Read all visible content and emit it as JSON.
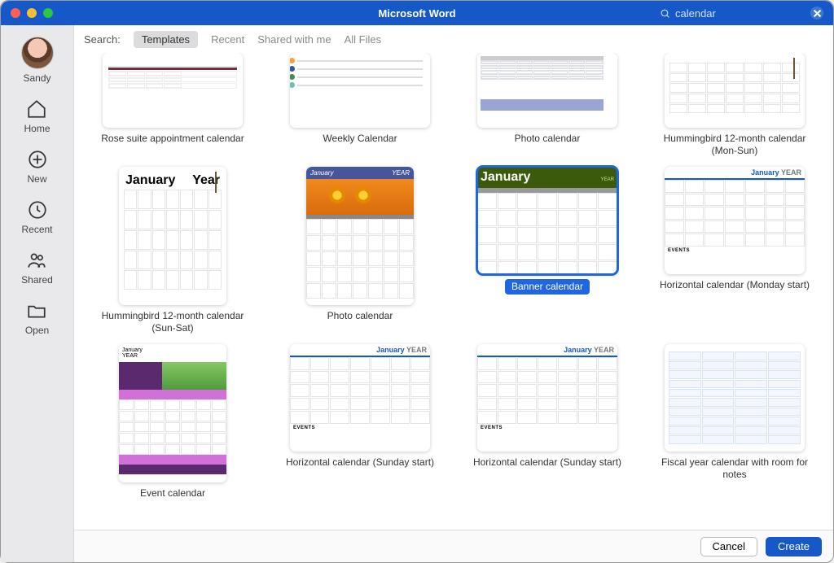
{
  "titlebar": {
    "title": "Microsoft Word"
  },
  "search": {
    "value": "calendar"
  },
  "user": {
    "name": "Sandy"
  },
  "sidebar": {
    "home": "Home",
    "new": "New",
    "recent": "Recent",
    "shared": "Shared",
    "open": "Open"
  },
  "filter": {
    "label": "Search:",
    "tabs": [
      "Templates",
      "Recent",
      "Shared with me",
      "All Files"
    ],
    "active_index": 0
  },
  "templates": [
    {
      "label": "Rose suite appointment calendar",
      "shape": "short",
      "kind": "rose"
    },
    {
      "label": "Weekly Calendar",
      "shape": "short",
      "kind": "weekly"
    },
    {
      "label": "Photo calendar",
      "shape": "short",
      "kind": "photo1"
    },
    {
      "label": "Hummingbird 12-month calendar (Mon-Sun)",
      "shape": "short",
      "kind": "humm"
    },
    {
      "label": "Hummingbird 12-month calendar (Sun-Sat)",
      "shape": "portrait",
      "kind": "humm2",
      "head": {
        "month": "January",
        "year": "Year"
      }
    },
    {
      "label": "Photo calendar",
      "shape": "portrait",
      "kind": "photo2",
      "head": {
        "month": "January",
        "year": "YEAR"
      }
    },
    {
      "label": "Banner calendar",
      "shape": "land",
      "kind": "banner",
      "selected": true,
      "head": {
        "month": "January",
        "year": "YEAR"
      }
    },
    {
      "label": "Horizontal calendar (Monday start)",
      "shape": "land",
      "kind": "horiz",
      "head": {
        "month": "January",
        "year": "YEAR"
      },
      "events": "EVENTS"
    },
    {
      "label": "Event calendar",
      "shape": "portrait",
      "kind": "eventcal",
      "head": {
        "month": "January",
        "year": "YEAR"
      }
    },
    {
      "label": "Horizontal calendar (Sunday start)",
      "shape": "land",
      "kind": "horiz",
      "head": {
        "month": "January",
        "year": "YEAR"
      },
      "events": "EVENTS"
    },
    {
      "label": "Horizontal calendar (Sunday start)",
      "shape": "land",
      "kind": "horiz",
      "head": {
        "month": "January",
        "year": "YEAR"
      },
      "events": "EVENTS"
    },
    {
      "label": "Fiscal year calendar with room for notes",
      "shape": "land",
      "kind": "fiscal"
    }
  ],
  "footer": {
    "cancel": "Cancel",
    "create": "Create"
  }
}
